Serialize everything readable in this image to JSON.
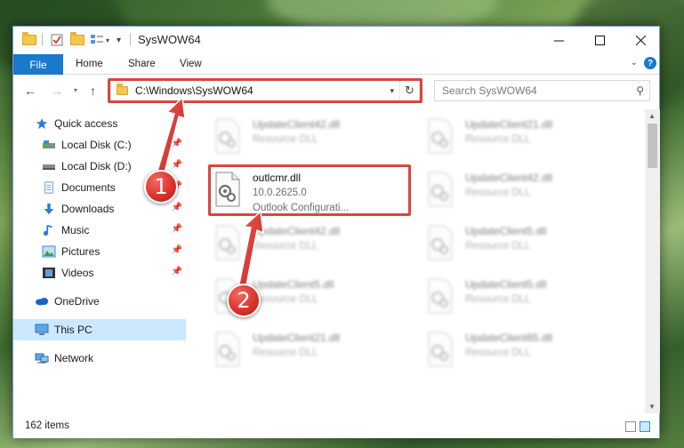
{
  "window": {
    "title": "SysWOW64",
    "controls": {
      "minimize": "—",
      "maximize": "☐",
      "close": "✕"
    }
  },
  "ribbon": {
    "file_label": "File",
    "tabs": [
      "Home",
      "Share",
      "View"
    ],
    "expand_icon": "chevron-down-icon",
    "help": "?"
  },
  "nav": {
    "address": "C:\\Windows\\SysWOW64",
    "search_placeholder": "Search SysWOW64"
  },
  "sidebar": {
    "items": [
      {
        "label": "Quick access",
        "icon": "star-icon"
      },
      {
        "label": "Local Disk (C:)",
        "icon": "drive-icon",
        "pinned": true
      },
      {
        "label": "Local Disk (D:)",
        "icon": "drive-icon",
        "pinned": true
      },
      {
        "label": "Documents",
        "icon": "document-icon",
        "pinned": true
      },
      {
        "label": "Downloads",
        "icon": "download-icon",
        "pinned": true
      },
      {
        "label": "Music",
        "icon": "music-icon",
        "pinned": true
      },
      {
        "label": "Pictures",
        "icon": "pictures-icon",
        "pinned": true
      },
      {
        "label": "Videos",
        "icon": "videos-icon",
        "pinned": true
      },
      {
        "label": "OneDrive",
        "icon": "cloud-icon"
      },
      {
        "label": "This PC",
        "icon": "computer-icon",
        "selected": true
      },
      {
        "label": "Network",
        "icon": "network-icon"
      }
    ]
  },
  "files": {
    "highlighted": {
      "name": "outlcmr.dll",
      "version": "10.0.2625.0",
      "description": "Outlook Configurati..."
    },
    "left_column": [
      {
        "name": "UpdateClient42.dll",
        "type": "Resource DLL"
      },
      {
        "name": "UpdateClient42.dll",
        "type": "Resource DLL"
      },
      {
        "name": "UpdateClient5.dll",
        "type": "Resource DLL"
      },
      {
        "name": "UpdateClient21.dll",
        "type": "Resource DLL"
      }
    ],
    "right_column": [
      {
        "name": "UpdateClient21.dll",
        "type": "Resource DLL"
      },
      {
        "name": "UpdateClient42.dll",
        "type": "Resource DLL"
      },
      {
        "name": "UpdateClient5.dll",
        "type": "Resource DLL"
      },
      {
        "name": "UpdateClient5.dll",
        "type": "Resource DLL"
      },
      {
        "name": "UpdateClient65.dll",
        "type": "Resource DLL"
      }
    ]
  },
  "status": {
    "item_count": "162 items"
  },
  "callouts": {
    "step1": "1",
    "step2": "2"
  },
  "colors": {
    "accent": "#1979ca",
    "highlight": "#d9463e",
    "selected": "#cce8ff"
  }
}
